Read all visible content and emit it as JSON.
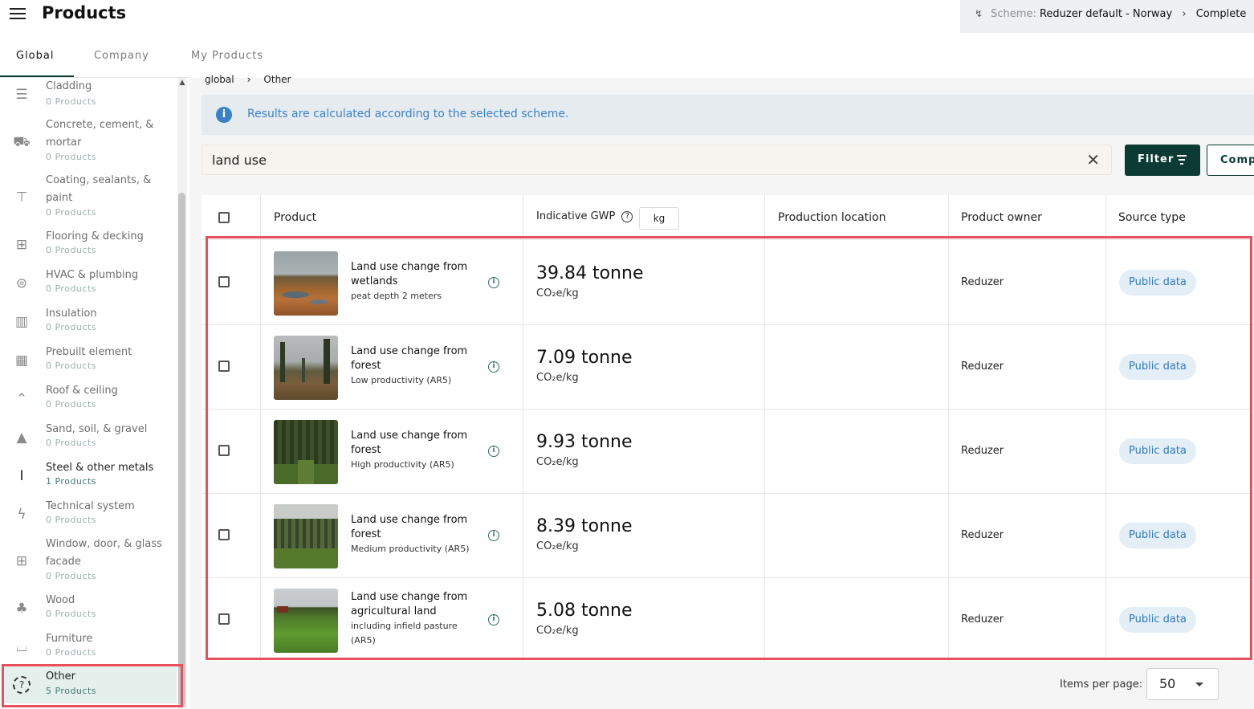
{
  "header": {
    "title": "Products",
    "scheme_label": "Scheme:",
    "scheme_value": "Reduzer default - Norway",
    "scheme_status": "Complete"
  },
  "tabs": [
    {
      "label": "Global"
    },
    {
      "label": "Company"
    },
    {
      "label": "My Products"
    }
  ],
  "sidebar": {
    "items": [
      {
        "name": "Cladding",
        "count": "0 Products",
        "icon": "cladding-icon"
      },
      {
        "name": "Concrete, cement, & mortar",
        "count": "0 Products",
        "icon": "wheelbarrow-icon"
      },
      {
        "name": "Coating, sealants, & paint",
        "count": "0 Products",
        "icon": "paint-roller-icon"
      },
      {
        "name": "Flooring & decking",
        "count": "0 Products",
        "icon": "flooring-icon"
      },
      {
        "name": "HVAC & plumbing",
        "count": "0 Products",
        "icon": "hvac-icon"
      },
      {
        "name": "Insulation",
        "count": "0 Products",
        "icon": "insulation-icon"
      },
      {
        "name": "Prebuilt element",
        "count": "0 Products",
        "icon": "prebuilt-icon"
      },
      {
        "name": "Roof & ceiling",
        "count": "0 Products",
        "icon": "roof-icon"
      },
      {
        "name": "Sand, soil, & gravel",
        "count": "0 Products",
        "icon": "terrain-icon"
      },
      {
        "name": "Steel & other metals",
        "count": "1 Products",
        "icon": "steel-beam-icon"
      },
      {
        "name": "Technical system",
        "count": "0 Products",
        "icon": "lightning-icon"
      },
      {
        "name": "Window, door, & glass facade",
        "count": "0 Products",
        "icon": "window-icon"
      },
      {
        "name": "Wood",
        "count": "0 Products",
        "icon": "tree-icon"
      },
      {
        "name": "Furniture",
        "count": "0 Products",
        "icon": "sofa-icon"
      },
      {
        "name": "Other",
        "count": "5 Products",
        "icon": "question-icon"
      }
    ]
  },
  "breadcrumb": {
    "root": "global",
    "current": "Other"
  },
  "info_banner": {
    "icon": "info-icon",
    "text": "Results are calculated according to the selected scheme."
  },
  "search": {
    "value": "land use",
    "placeholder": ""
  },
  "toolbar": {
    "filter_label": "Filter",
    "compare_label": "Comp"
  },
  "table": {
    "columns": {
      "product": "Product",
      "gwp": "Indicative GWP",
      "gwp_unit": "kg",
      "location": "Production location",
      "owner": "Product owner",
      "source": "Source type"
    },
    "rows": [
      {
        "name": "Land use change from wetlands",
        "desc": "peat depth 2 meters",
        "gwp": "39.84 tonne",
        "unit": "CO₂e/kg",
        "owner": "Reduzer",
        "source": "Public data",
        "thumb": "wetland"
      },
      {
        "name": "Land use change from forest",
        "desc": "Low productivity (AR5)",
        "gwp": "7.09 tonne",
        "unit": "CO₂e/kg",
        "owner": "Reduzer",
        "source": "Public data",
        "thumb": "sparse-forest"
      },
      {
        "name": "Land use change from forest",
        "desc": "High productivity (AR5)",
        "gwp": "9.93 tonne",
        "unit": "CO₂e/kg",
        "owner": "Reduzer",
        "source": "Public data",
        "thumb": "dense-forest"
      },
      {
        "name": "Land use change from forest",
        "desc": "Medium productivity (AR5)",
        "gwp": "8.39 tonne",
        "unit": "CO₂e/kg",
        "owner": "Reduzer",
        "source": "Public data",
        "thumb": "medium-forest"
      },
      {
        "name": "Land use change from agricultural land",
        "desc": "including infield pasture (AR5)",
        "gwp": "5.08 tonne",
        "unit": "CO₂e/kg",
        "owner": "Reduzer",
        "source": "Public data",
        "thumb": "farmland"
      }
    ]
  },
  "pager": {
    "label": "Items per page:",
    "value": "50"
  },
  "colors": {
    "primary": "#0b3b33",
    "highlight": "#e8505b",
    "info": "#3a82c8",
    "badge_bg": "#e3eef7"
  }
}
